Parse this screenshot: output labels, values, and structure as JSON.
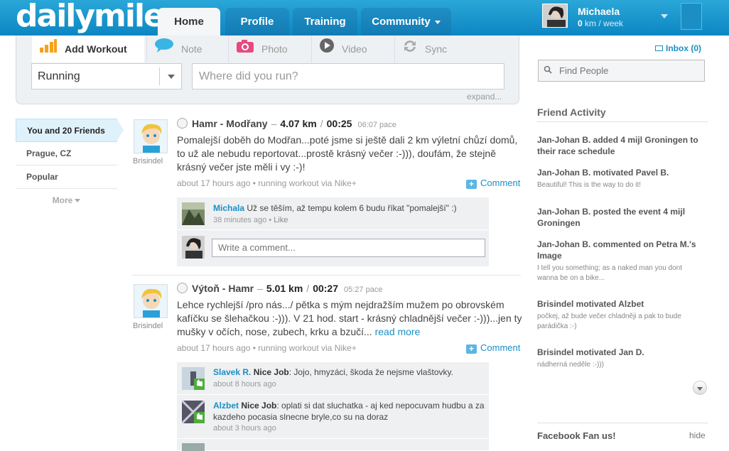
{
  "nav": {
    "logo": "dailymile",
    "tabs": [
      {
        "label": "Home"
      },
      {
        "label": "Profile"
      },
      {
        "label": "Training"
      },
      {
        "label": "Community"
      }
    ],
    "user": {
      "name": "Michaela",
      "km_value": "0",
      "km_unit": "km / week"
    }
  },
  "publisher": {
    "tabs": [
      {
        "label": "Add Workout"
      },
      {
        "label": "Note"
      },
      {
        "label": "Photo"
      },
      {
        "label": "Video"
      },
      {
        "label": "Sync"
      }
    ],
    "sport_value": "Running",
    "where_placeholder": "Where did you run?",
    "expand_label": "expand..."
  },
  "filters": {
    "items": [
      {
        "label": "You and 20 Friends"
      },
      {
        "label": "Prague, CZ"
      },
      {
        "label": "Popular"
      }
    ],
    "more_label": "More"
  },
  "feed": [
    {
      "user": "Brisindel",
      "route": "Hamr - Modřany",
      "distance": "4.07 km",
      "time": "00:25",
      "pace": "06:07 pace",
      "body": "Pomalejší doběh do Modřan...poté jsme si ještě dali 2 km výletní chůzí domů, to už ale nebudu reportovat...prostě krásný večer :-))), doufám, že stejně krásný večer jste měli i vy :-)!",
      "meta": "about 17 hours ago",
      "meta_via": "running workout via Nike+",
      "comment_label": "Comment",
      "comments": [
        {
          "author": "Michala",
          "text": "Už se těším, až tempu kolem 6 budu říkat \"pomalejší\" :)",
          "time": "38 minutes ago",
          "like": "Like"
        }
      ],
      "write_placeholder": "Write a comment..."
    },
    {
      "user": "Brisindel",
      "route": "Výtoň - Hamr",
      "distance": "5.01 km",
      "time": "00:27",
      "pace": "05:27 pace",
      "body": "Lehce rychlejší /pro nás.../ pětka s mým nejdražším mužem po obrovském kafíčku se šlehačkou :-))). V 21 hod. start - krásný chladnější večer :-)))...jen ty mušky v očích, nose, zubech, krku a bzučí...",
      "read_more": "read more",
      "meta": "about 17 hours ago",
      "meta_via": "running workout via Nike+",
      "comment_label": "Comment",
      "comments": [
        {
          "author": "Slavek R.",
          "nice": "Nice Job",
          "text": ": Jojo, hmyzáci, škoda že nejsme vlaštovky.",
          "time": "about 8 hours ago"
        },
        {
          "author": "Alzbet",
          "nice": "Nice Job",
          "text": ": oplati si dat sluchatka - aj ked nepocuvam hudbu a za kazdeho pocasia slnecne bryle,co su na doraz",
          "time": "about 3 hours ago"
        }
      ]
    }
  ],
  "sidebar": {
    "inbox_label": "Inbox (0)",
    "find_placeholder": "Find People",
    "friend_activity_title": "Friend Activity",
    "activity": [
      {
        "head": "Jan-Johan B. added 4 mijl Groningen to their race schedule",
        "sub": ""
      },
      {
        "head": "Jan-Johan B. motivated Pavel B.",
        "sub": "Beautiful! This is the way to do it!"
      },
      {
        "head": "Jan-Johan B. posted the event 4 mijl Groningen",
        "sub": ""
      },
      {
        "head": "Jan-Johan B. commented on Petra M.'s Image",
        "sub": "I tell you something; as a naked man you dont wanna be on a bike..."
      },
      {
        "head": "Brisindel motivated Alzbet",
        "sub": "počkej, až bude večer chladněji a pak to bude parádička :-)"
      },
      {
        "head": "Brisindel motivated Jan D.",
        "sub": "nádherná neděle :-)))"
      }
    ],
    "facebook_title": "Facebook Fan us!",
    "hide_label": "hide"
  }
}
